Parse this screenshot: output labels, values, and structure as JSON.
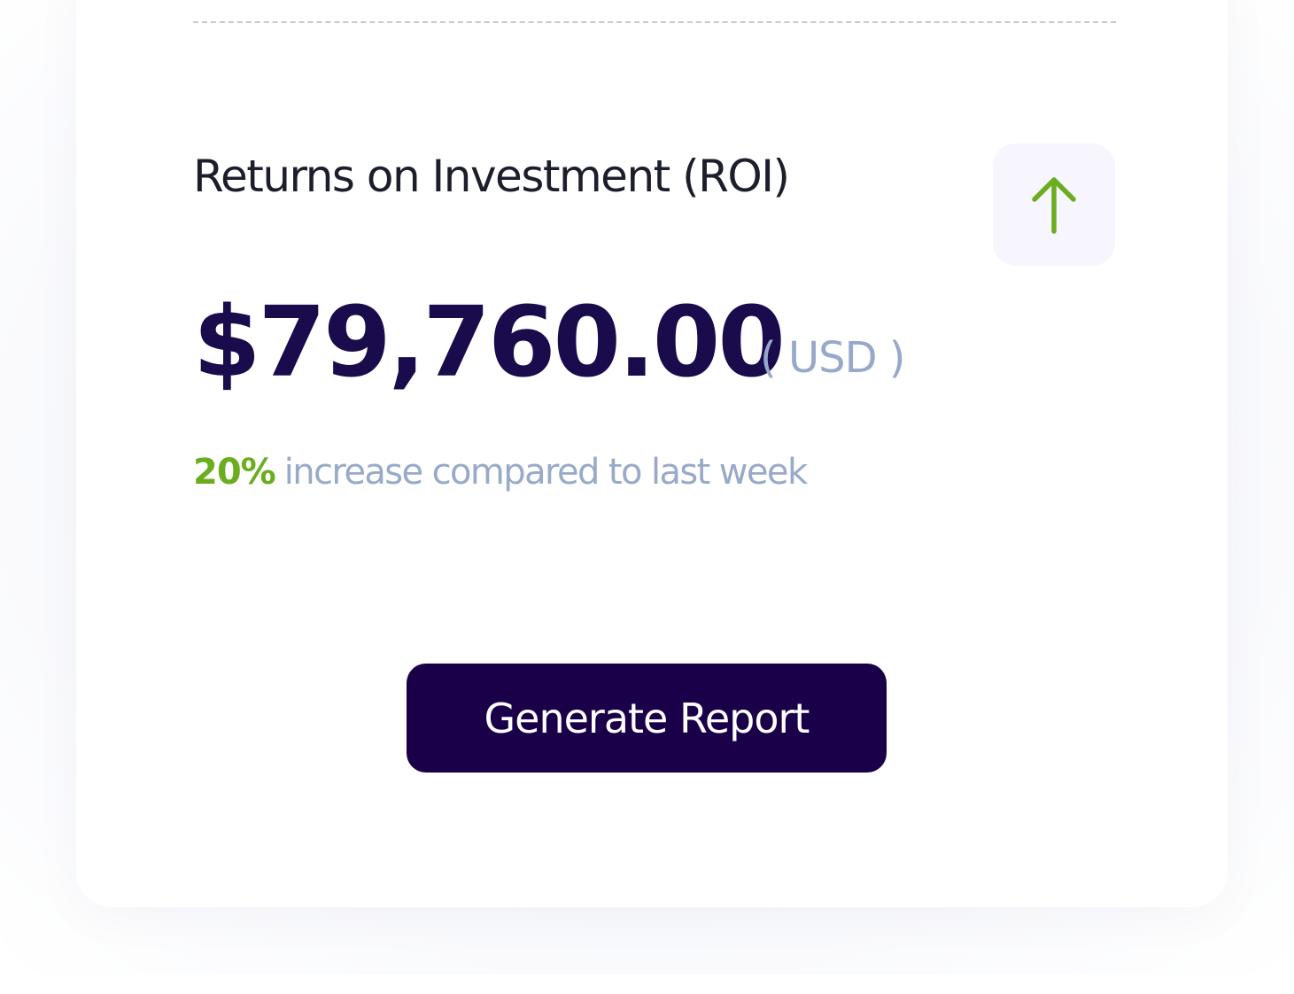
{
  "card": {
    "title": "Returns on  Investment (ROI)",
    "amount": "$79,760.00",
    "currency": "( USD )",
    "change_percent": "20%",
    "change_text": "increase compared to last week",
    "trend_icon": "arrow-up-icon"
  },
  "actions": {
    "generate_report_label": "Generate Report"
  },
  "colors": {
    "amount": "#1a0b4d",
    "positive": "#6aad1f",
    "muted": "#98aac8",
    "button_bg": "#1a0049",
    "icon_bg": "#f7f5fd"
  }
}
